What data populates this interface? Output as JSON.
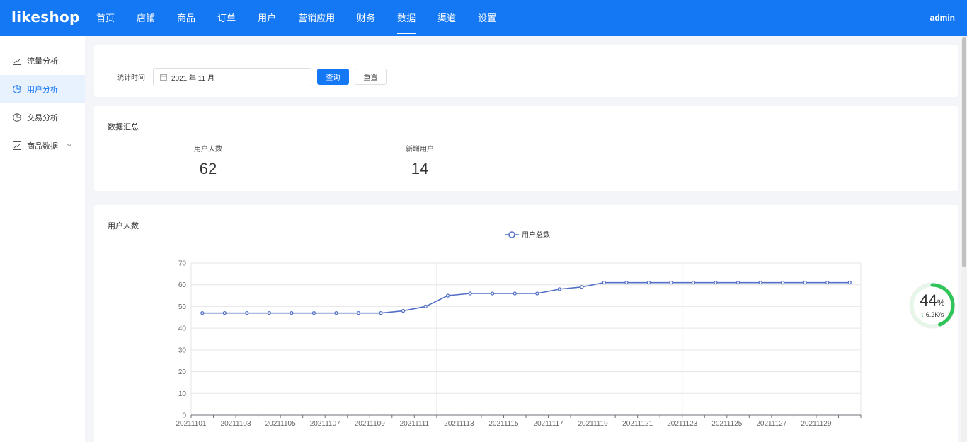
{
  "app": {
    "logo": "likeshop",
    "user": "admin"
  },
  "nav": [
    "首页",
    "店铺",
    "商品",
    "订单",
    "用户",
    "营销应用",
    "财务",
    "数据",
    "渠道",
    "设置"
  ],
  "nav_active_index": 7,
  "sidebar": {
    "items": [
      {
        "label": "流量分析",
        "icon": "line-chart-icon",
        "active": false
      },
      {
        "label": "用户分析",
        "icon": "pie-chart-icon",
        "active": true
      },
      {
        "label": "交易分析",
        "icon": "pie-chart-icon",
        "active": false
      },
      {
        "label": "商品数据",
        "icon": "line-chart-icon",
        "active": false,
        "expandable": true
      }
    ]
  },
  "filter": {
    "label": "统计时间",
    "date_value": "2021 年 11 月",
    "query_label": "查询",
    "reset_label": "重置"
  },
  "summary": {
    "title": "数据汇总",
    "stats": [
      {
        "label": "用户人数",
        "value": "62"
      },
      {
        "label": "新增用户",
        "value": "14"
      }
    ]
  },
  "chart_section": {
    "title": "用户人数"
  },
  "chart_data": {
    "type": "line",
    "title": "",
    "legend": [
      "用户总数"
    ],
    "legend_position": "top-center",
    "ylim": [
      0,
      70
    ],
    "yticks": [
      0,
      10,
      20,
      30,
      40,
      50,
      60,
      70
    ],
    "grid": true,
    "x": [
      "20211101",
      "20211102",
      "20211103",
      "20211104",
      "20211105",
      "20211106",
      "20211107",
      "20211108",
      "20211109",
      "20211110",
      "20211111",
      "20211112",
      "20211113",
      "20211114",
      "20211115",
      "20211116",
      "20211117",
      "20211118",
      "20211119",
      "20211120",
      "20211121",
      "20211122",
      "20211123",
      "20211124",
      "20211125",
      "20211126",
      "20211127",
      "20211128",
      "20211129",
      "20211130"
    ],
    "x_tick_labels": [
      "20211101",
      "20211103",
      "20211105",
      "20211107",
      "20211109",
      "20211111",
      "20211113",
      "20211115",
      "20211117",
      "20211119",
      "20211121",
      "20211123",
      "20211125",
      "20211127",
      "20211129"
    ],
    "series": [
      {
        "name": "用户总数",
        "color": "#5470c6",
        "values": [
          47,
          47,
          47,
          47,
          47,
          47,
          47,
          47,
          47,
          48,
          50,
          55,
          56,
          56,
          56,
          56,
          58,
          59,
          61,
          61,
          61,
          61,
          61,
          61,
          61,
          61,
          61,
          61,
          61,
          61
        ]
      }
    ]
  },
  "speed_widget": {
    "percent": "44",
    "percent_unit": "%",
    "rate": "6.2K/s",
    "level": 0.44,
    "color": "#2fc45a"
  },
  "colors": {
    "primary": "#1478f5",
    "sidebar_active_bg": "#e8f1fe"
  }
}
